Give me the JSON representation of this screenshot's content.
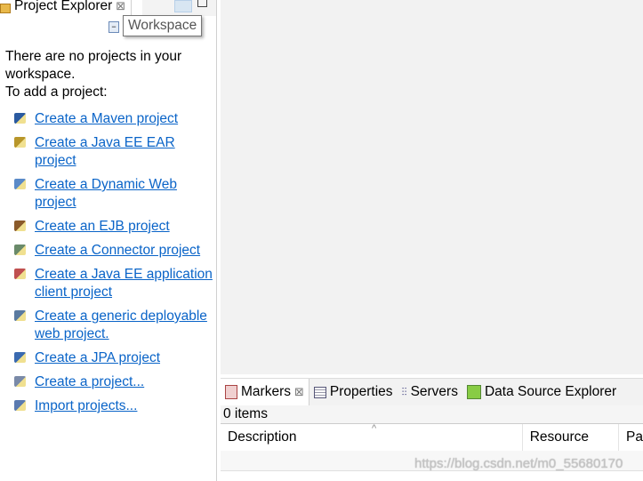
{
  "explorer": {
    "tab_title": "Project Explorer",
    "tooltip": "Workspace",
    "message_line1": "There are no projects in your workspace.",
    "message_line2": "To add a project:",
    "links": [
      {
        "label": "Create a Maven project",
        "icon": "maven-icon"
      },
      {
        "label": "Create a Java EE EAR project",
        "icon": "ear-project-icon"
      },
      {
        "label": "Create a Dynamic Web project",
        "icon": "web-project-icon"
      },
      {
        "label": "Create an EJB project",
        "icon": "ejb-project-icon"
      },
      {
        "label": "Create a Connector project",
        "icon": "connector-project-icon"
      },
      {
        "label": "Create a Java EE application client project",
        "icon": "app-client-icon"
      },
      {
        "label": "Create a generic deployable web project.",
        "icon": "generic-web-icon"
      },
      {
        "label": "Create a JPA project",
        "icon": "jpa-project-icon"
      },
      {
        "label": "Create a project...",
        "icon": "new-project-icon"
      },
      {
        "label": "Import projects...",
        "icon": "import-icon"
      }
    ]
  },
  "bottom": {
    "tabs": [
      {
        "label": "Markers"
      },
      {
        "label": "Properties"
      },
      {
        "label": "Servers"
      },
      {
        "label": "Data Source Explorer"
      }
    ],
    "count": "0 items",
    "columns": [
      "Description",
      "Resource",
      "Pa"
    ]
  },
  "watermark": "https://blog.csdn.net/m0_55680170"
}
